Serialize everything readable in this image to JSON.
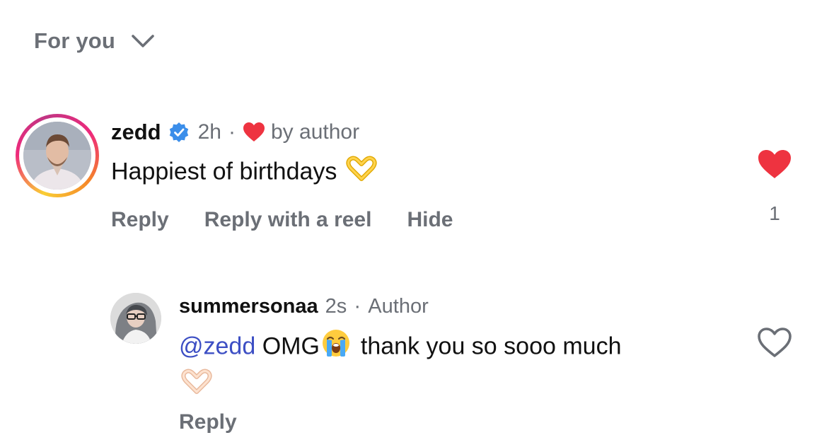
{
  "sort": {
    "label": "For you",
    "icon": "chevron-down-icon"
  },
  "colors": {
    "like_red": "#ee3340",
    "mention_blue": "#3d4fc4",
    "meta_gray": "#6b6f76",
    "verified_blue": "#3b8eea"
  },
  "comments": [
    {
      "username": "zedd",
      "verified": true,
      "time": "2h",
      "separator": "·",
      "liked_by_author_label": "by author",
      "text": "Happiest of birthdays",
      "emoji": "🫶",
      "actions": [
        "Reply",
        "Reply with a reel",
        "Hide"
      ],
      "liked": true,
      "like_count": "1"
    },
    {
      "username": "summersonaa",
      "time": "2s",
      "separator": "·",
      "role": "Author",
      "mention": "@zedd",
      "text_before_emoji": "OMG",
      "emoji_crying": "😭",
      "text_after_emoji": "thank you so sooo much",
      "emoji_end": "🫶🏻",
      "actions": [
        "Reply"
      ],
      "liked": false
    }
  ]
}
